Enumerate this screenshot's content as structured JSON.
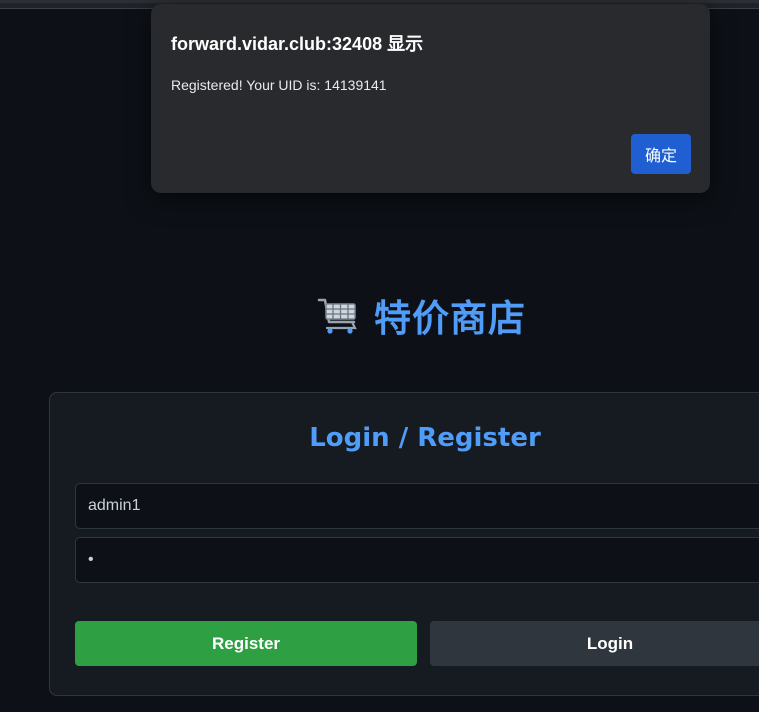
{
  "dialog": {
    "title": "forward.vidar.club:32408 显示",
    "message": "Registered! Your UID is: 14139141",
    "ok_label": "确定"
  },
  "brand": {
    "icon": "shopping-cart-icon",
    "title": "特价商店"
  },
  "auth": {
    "heading": "Login / Register",
    "username_value": "admin1",
    "password_value": "1",
    "register_label": "Register",
    "login_label": "Login"
  },
  "colors": {
    "background": "#0d1117",
    "card": "#161b22",
    "accent": "#4f9cf9",
    "register": "#2ea043",
    "login": "#30363d",
    "dialog": "#292a2d",
    "dialog_button": "#1f5fd1"
  }
}
